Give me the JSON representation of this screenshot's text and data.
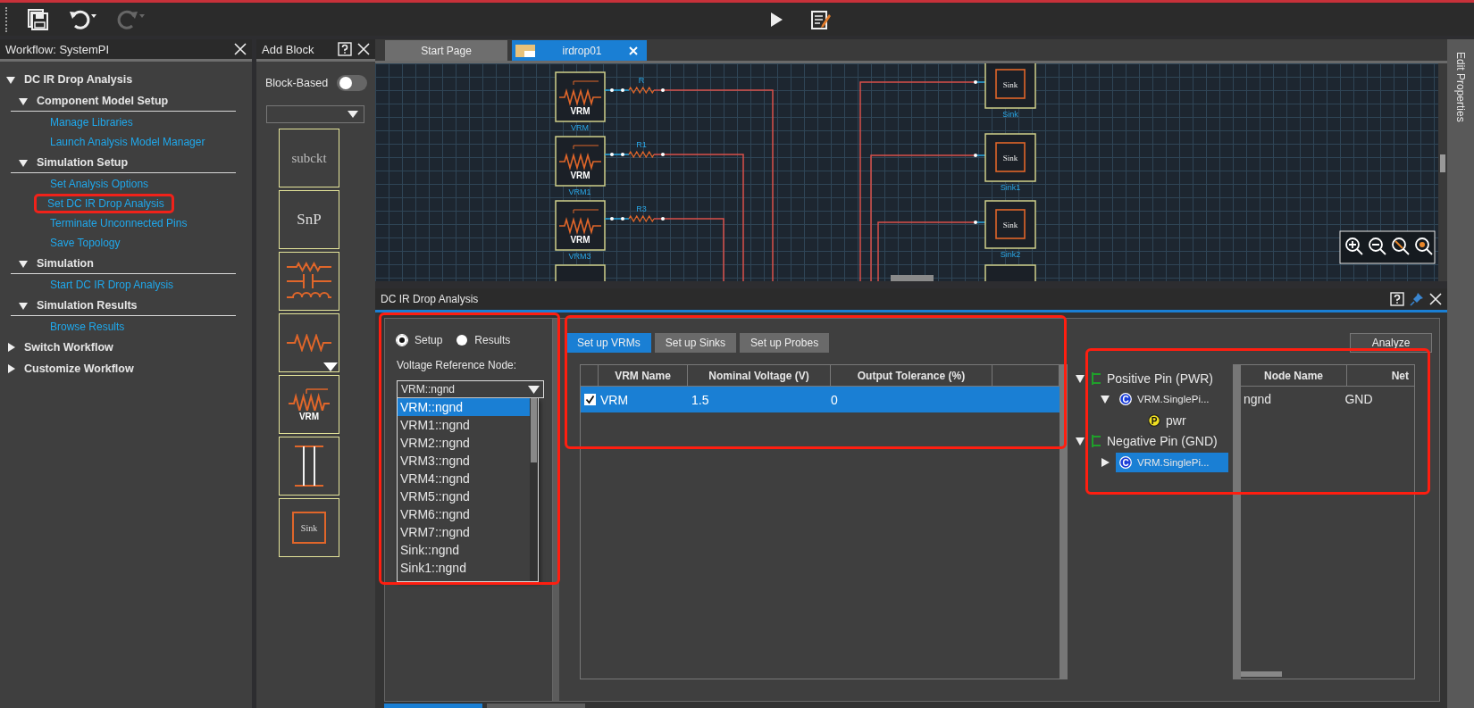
{
  "toolbar": {
    "left": [
      {
        "kind": "save",
        "disabled": false
      },
      {
        "kind": "undo",
        "disabled": false
      },
      {
        "kind": "redo",
        "disabled": true
      }
    ],
    "center": [
      {
        "kind": "run",
        "disabled": false
      },
      {
        "kind": "notes",
        "disabled": false
      }
    ]
  },
  "workflow": {
    "title": "Workflow: SystemPI",
    "items": [
      {
        "kind": "section",
        "label": "DC IR Drop Analysis",
        "expanded": true,
        "children": [
          {
            "kind": "group",
            "label": "Component Model Setup",
            "expanded": true,
            "children": [
              {
                "kind": "link",
                "label": "Manage Libraries",
                "marked": false
              },
              {
                "kind": "link",
                "label": "Launch Analysis Model Manager",
                "marked": false
              }
            ]
          },
          {
            "kind": "group",
            "label": "Simulation Setup",
            "expanded": true,
            "children": [
              {
                "kind": "link",
                "label": "Set Analysis Options",
                "marked": false
              },
              {
                "kind": "link",
                "label": "Set DC IR Drop Analysis",
                "marked": true
              },
              {
                "kind": "link",
                "label": "Terminate Unconnected Pins",
                "marked": false
              },
              {
                "kind": "link",
                "label": "Save Topology",
                "marked": false
              }
            ]
          },
          {
            "kind": "group",
            "label": "Simulation",
            "expanded": true,
            "children": [
              {
                "kind": "link",
                "label": "Start DC IR Drop Analysis",
                "marked": false
              }
            ]
          },
          {
            "kind": "group",
            "label": "Simulation Results",
            "expanded": true,
            "children": [
              {
                "kind": "link",
                "label": "Browse Results",
                "marked": false
              }
            ]
          }
        ]
      },
      {
        "kind": "section",
        "label": "Switch Workflow",
        "expanded": false
      },
      {
        "kind": "section",
        "label": "Customize Workflow",
        "expanded": false
      }
    ]
  },
  "add_block": {
    "title": "Add Block",
    "toggle": {
      "label": "Block-Based",
      "on": false
    },
    "blocks": [
      {
        "kind": "subckt",
        "text": "subckt"
      },
      {
        "kind": "snp",
        "text": "SnP"
      },
      {
        "kind": "rlc"
      },
      {
        "kind": "resistor"
      },
      {
        "kind": "vrm",
        "text": "VRM"
      },
      {
        "kind": "tline"
      },
      {
        "kind": "sink",
        "text": "Sink"
      }
    ]
  },
  "tabs": [
    {
      "label": "Start Page",
      "selected": false
    },
    {
      "label": "irdrop01",
      "selected": true
    }
  ],
  "schematic": {
    "sources": [
      {
        "kind": "full",
        "name": "VRM",
        "symbol": "VRM",
        "resistor": "R"
      },
      {
        "kind": "full",
        "name": "VRM1",
        "symbol": "VRM",
        "resistor": "R1"
      },
      {
        "kind": "full",
        "name": "VRM3",
        "symbol": "VRM",
        "resistor": "R3"
      },
      {
        "kind": "cut"
      }
    ],
    "sinks": [
      {
        "kind": "full",
        "name": "Sink",
        "symbol": "Sink"
      },
      {
        "kind": "full",
        "name": "Sink1",
        "symbol": "Sink"
      },
      {
        "kind": "full",
        "name": "Sink2",
        "symbol": "Sink"
      },
      {
        "kind": "cut"
      }
    ]
  },
  "side_strip": {
    "label": "Edit Properties"
  },
  "analysis": {
    "title": "DC IR Drop Analysis",
    "modes": [
      {
        "label": "Setup",
        "selected": true
      },
      {
        "label": "Results",
        "selected": false
      }
    ],
    "reference_label": "Voltage Reference Node:",
    "reference_value": "VRM::ngnd",
    "reference_options": [
      {
        "label": "VRM::ngnd",
        "selected": true
      },
      {
        "label": "VRM1::ngnd",
        "selected": false
      },
      {
        "label": "VRM2::ngnd",
        "selected": false
      },
      {
        "label": "VRM3::ngnd",
        "selected": false
      },
      {
        "label": "VRM4::ngnd",
        "selected": false
      },
      {
        "label": "VRM5::ngnd",
        "selected": false
      },
      {
        "label": "VRM6::ngnd",
        "selected": false
      },
      {
        "label": "VRM7::ngnd",
        "selected": false
      },
      {
        "label": "Sink::ngnd",
        "selected": false
      },
      {
        "label": "Sink1::ngnd",
        "selected": false
      }
    ],
    "subtabs": [
      {
        "label": "Set up VRMs",
        "selected": true
      },
      {
        "label": "Set up Sinks",
        "selected": false
      },
      {
        "label": "Set up Probes",
        "selected": false
      }
    ],
    "vrm_table": {
      "columns": [
        "VRM Name",
        "Nominal Voltage (V)",
        "Output Tolerance (%)"
      ],
      "rows": [
        {
          "checked": true,
          "selected": true,
          "cells": [
            "VRM",
            "1.5",
            "0"
          ]
        }
      ]
    },
    "analyze_button": "Analyze",
    "pin_tree": [
      {
        "kind": "group",
        "label": "Positive Pin (PWR)",
        "expanded": true,
        "children": [
          {
            "kind": "component",
            "badge": "C",
            "label": "VRM.SinglePi...",
            "expanded": true,
            "selected": false,
            "children": [
              {
                "kind": "pin",
                "badge": "P",
                "label": "pwr",
                "selected": false
              }
            ]
          }
        ]
      },
      {
        "kind": "group",
        "label": "Negative Pin (GND)",
        "expanded": true,
        "children": [
          {
            "kind": "component",
            "badge": "C",
            "label": "VRM.SinglePi...",
            "expanded": false,
            "selected": true
          }
        ]
      }
    ],
    "node_table": {
      "columns": [
        "Node Name",
        "Net"
      ],
      "rows": [
        [
          "ngnd",
          "GND"
        ]
      ]
    }
  },
  "bottom_tabs": [
    {
      "selected": true
    },
    {
      "selected": false
    }
  ]
}
